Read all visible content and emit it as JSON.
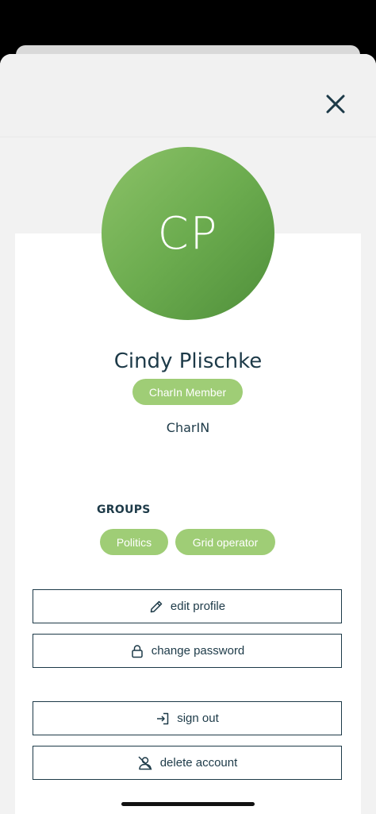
{
  "profile": {
    "initials": "CP",
    "name": "Cindy Plischke",
    "role_badge": "CharIn Member",
    "organization": "CharIN"
  },
  "groups": {
    "heading": "GROUPS",
    "items": [
      "Politics",
      "Grid operator"
    ]
  },
  "actions": {
    "edit_profile": "edit profile",
    "change_password": "change password",
    "sign_out": "sign out",
    "delete_account": "delete account"
  },
  "colors": {
    "accent_green": "#9fcd76",
    "avatar_green": "#6cac4f",
    "text_dark": "#1d3a48"
  },
  "icons": {
    "close": "close-icon",
    "edit": "pencil-icon",
    "password": "lock-icon",
    "sign_out": "sign-in-arrow-icon",
    "delete": "user-slash-icon"
  }
}
